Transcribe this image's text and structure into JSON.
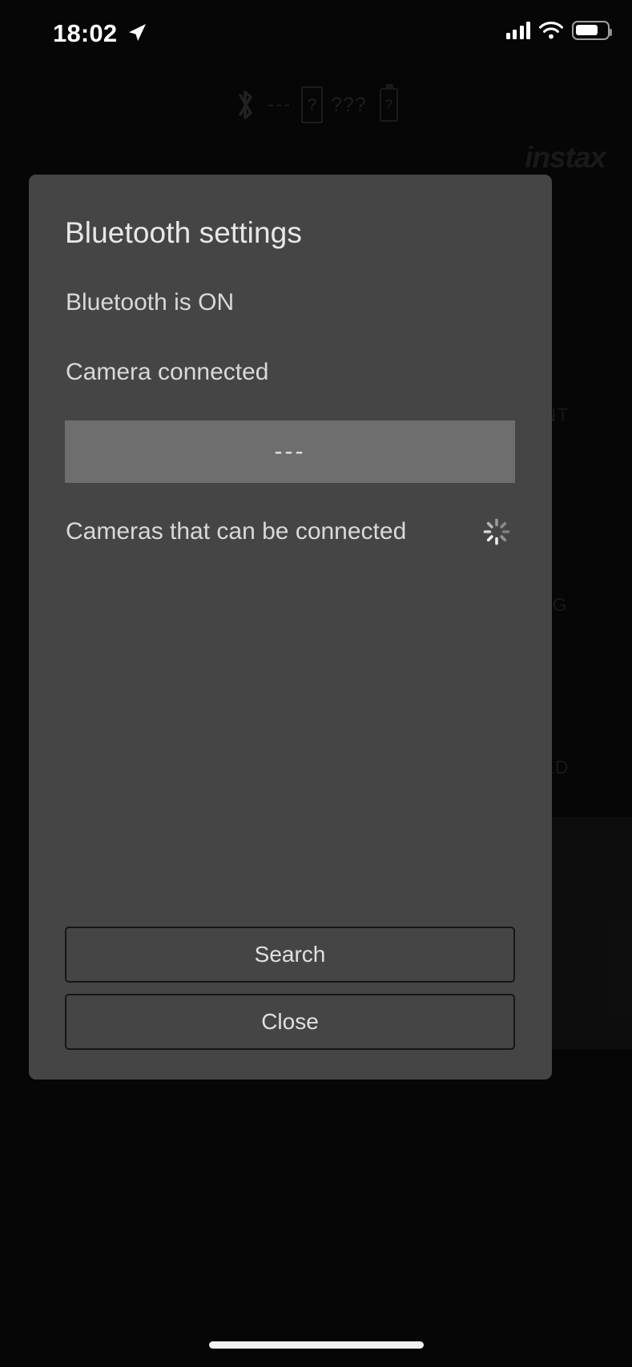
{
  "status_bar": {
    "time": "18:02",
    "location_icon": "location-arrow-icon",
    "cellular_icon": "cellular-bars-icon",
    "wifi_icon": "wifi-icon",
    "battery_icon": "battery-icon"
  },
  "background_app": {
    "brand": "instax",
    "bluetooth_icon": "bluetooth-icon",
    "bt_value": "---",
    "device_value": "?",
    "device_name_value": "???",
    "battery_value": "?",
    "ghost_texts": [
      "NT",
      "G",
      "ED"
    ]
  },
  "dialog": {
    "title": "Bluetooth settings",
    "bluetooth_status": "Bluetooth is ON",
    "camera_status": "Camera connected",
    "connected_device_name": "---",
    "available_label": "Cameras that can be connected",
    "spinner_icon": "loading-spinner-icon",
    "available_devices": [],
    "buttons": [
      {
        "label": "Search",
        "name": "search-button"
      },
      {
        "label": "Close",
        "name": "close-button"
      }
    ]
  },
  "colors": {
    "screen_background": "#0b0b0b",
    "dialog_background": "#454545",
    "device_bar_background": "#6e6e6e",
    "primary_text": "#e8e8e8",
    "body_text": "#d9d9d9",
    "button_border": "#161616"
  }
}
